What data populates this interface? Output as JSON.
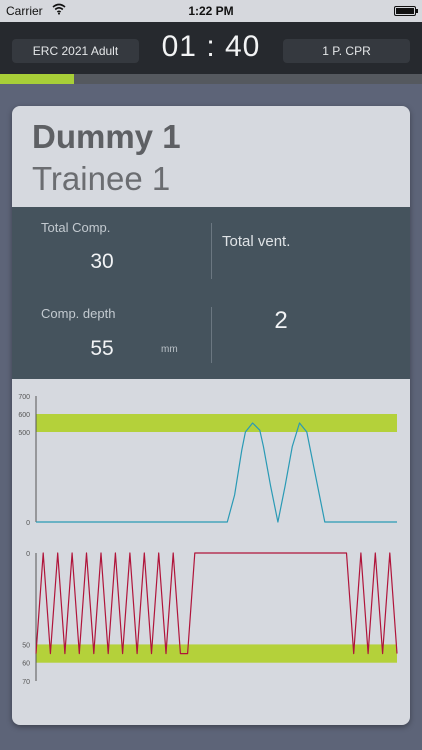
{
  "status_bar": {
    "carrier": "Carrier",
    "time": "1:22 PM"
  },
  "header": {
    "guideline": "ERC 2021 Adult",
    "timer": "01 : 40",
    "mode": "1 P. CPR"
  },
  "progress": {
    "fraction": 0.175,
    "color": "#a8cf38"
  },
  "card": {
    "dummy": "Dummy 1",
    "trainee": "Trainee 1",
    "stats": {
      "total_comp_label": "Total Comp.",
      "total_comp_value": "30",
      "total_vent_label": "Total vent.",
      "total_vent_value": "2",
      "comp_depth_label": "Comp. depth",
      "comp_depth_value": "55",
      "comp_depth_unit": "mm"
    }
  },
  "colors": {
    "target_band": "#b4d13a",
    "ventilation_line": "#2a9ab5",
    "compression_line": "#b0143a"
  },
  "chart_data": [
    {
      "type": "line",
      "name": "ventilation",
      "y_ticks": [
        "700",
        "600",
        "500",
        "0"
      ],
      "y_tick_values": [
        700,
        600,
        500,
        0
      ],
      "ylim": [
        0,
        700
      ],
      "target_band": [
        500,
        600
      ],
      "x": [
        0,
        50,
        53,
        55,
        57,
        58,
        60,
        62,
        63,
        65,
        67,
        69,
        71,
        73,
        75,
        77,
        80,
        100
      ],
      "values": [
        0,
        0,
        0,
        150,
        400,
        500,
        550,
        510,
        420,
        200,
        0,
        200,
        420,
        550,
        500,
        300,
        0,
        0
      ]
    },
    {
      "type": "line",
      "name": "compression",
      "y_ticks": [
        "0",
        "50",
        "60",
        "70"
      ],
      "y_tick_values": [
        0,
        50,
        60,
        70
      ],
      "ylim": [
        0,
        70
      ],
      "inverted": true,
      "target_band": [
        50,
        60
      ],
      "x": [
        0,
        2,
        4,
        6,
        8,
        10,
        12,
        14,
        16,
        18,
        20,
        22,
        24,
        26,
        28,
        30,
        32,
        34,
        36,
        38,
        40,
        42,
        44,
        86,
        88,
        90,
        92,
        94,
        96,
        98,
        100
      ],
      "values": [
        55,
        0,
        55,
        0,
        55,
        0,
        55,
        0,
        55,
        0,
        55,
        0,
        55,
        0,
        55,
        0,
        55,
        0,
        55,
        0,
        55,
        55,
        0,
        0,
        55,
        0,
        55,
        0,
        55,
        0,
        55
      ]
    }
  ]
}
